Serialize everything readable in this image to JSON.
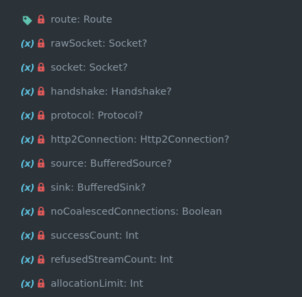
{
  "outline": {
    "cut_item": "",
    "items": [
      {
        "kind": "tag",
        "kind_text": "",
        "label": "route: Route"
      },
      {
        "kind": "variable",
        "kind_text": "(x)",
        "label": "rawSocket: Socket?"
      },
      {
        "kind": "variable",
        "kind_text": "(x)",
        "label": "socket: Socket?"
      },
      {
        "kind": "variable",
        "kind_text": "(x)",
        "label": "handshake: Handshake?"
      },
      {
        "kind": "variable",
        "kind_text": "(x)",
        "label": "protocol: Protocol?"
      },
      {
        "kind": "variable",
        "kind_text": "(x)",
        "label": "http2Connection: Http2Connection?"
      },
      {
        "kind": "variable",
        "kind_text": "(x)",
        "label": "source: BufferedSource?"
      },
      {
        "kind": "variable",
        "kind_text": "(x)",
        "label": "sink: BufferedSink?"
      },
      {
        "kind": "variable",
        "kind_text": "(x)",
        "label": "noCoalescedConnections: Boolean"
      },
      {
        "kind": "variable",
        "kind_text": "(x)",
        "label": "successCount: Int"
      },
      {
        "kind": "variable",
        "kind_text": "(x)",
        "label": "refusedStreamCount: Int"
      },
      {
        "kind": "variable",
        "kind_text": "(x)",
        "label": "allocationLimit: Int"
      }
    ]
  },
  "icons": {
    "tag": "tag-icon",
    "variable": "variable-icon",
    "lock": "lock-icon"
  },
  "colors": {
    "background": "#2b3238",
    "text": "#8a98a4",
    "variable_icon": "#5fc3e0",
    "tag_icon": "#5fc3b0",
    "lock_icon": "#e05a5a"
  }
}
